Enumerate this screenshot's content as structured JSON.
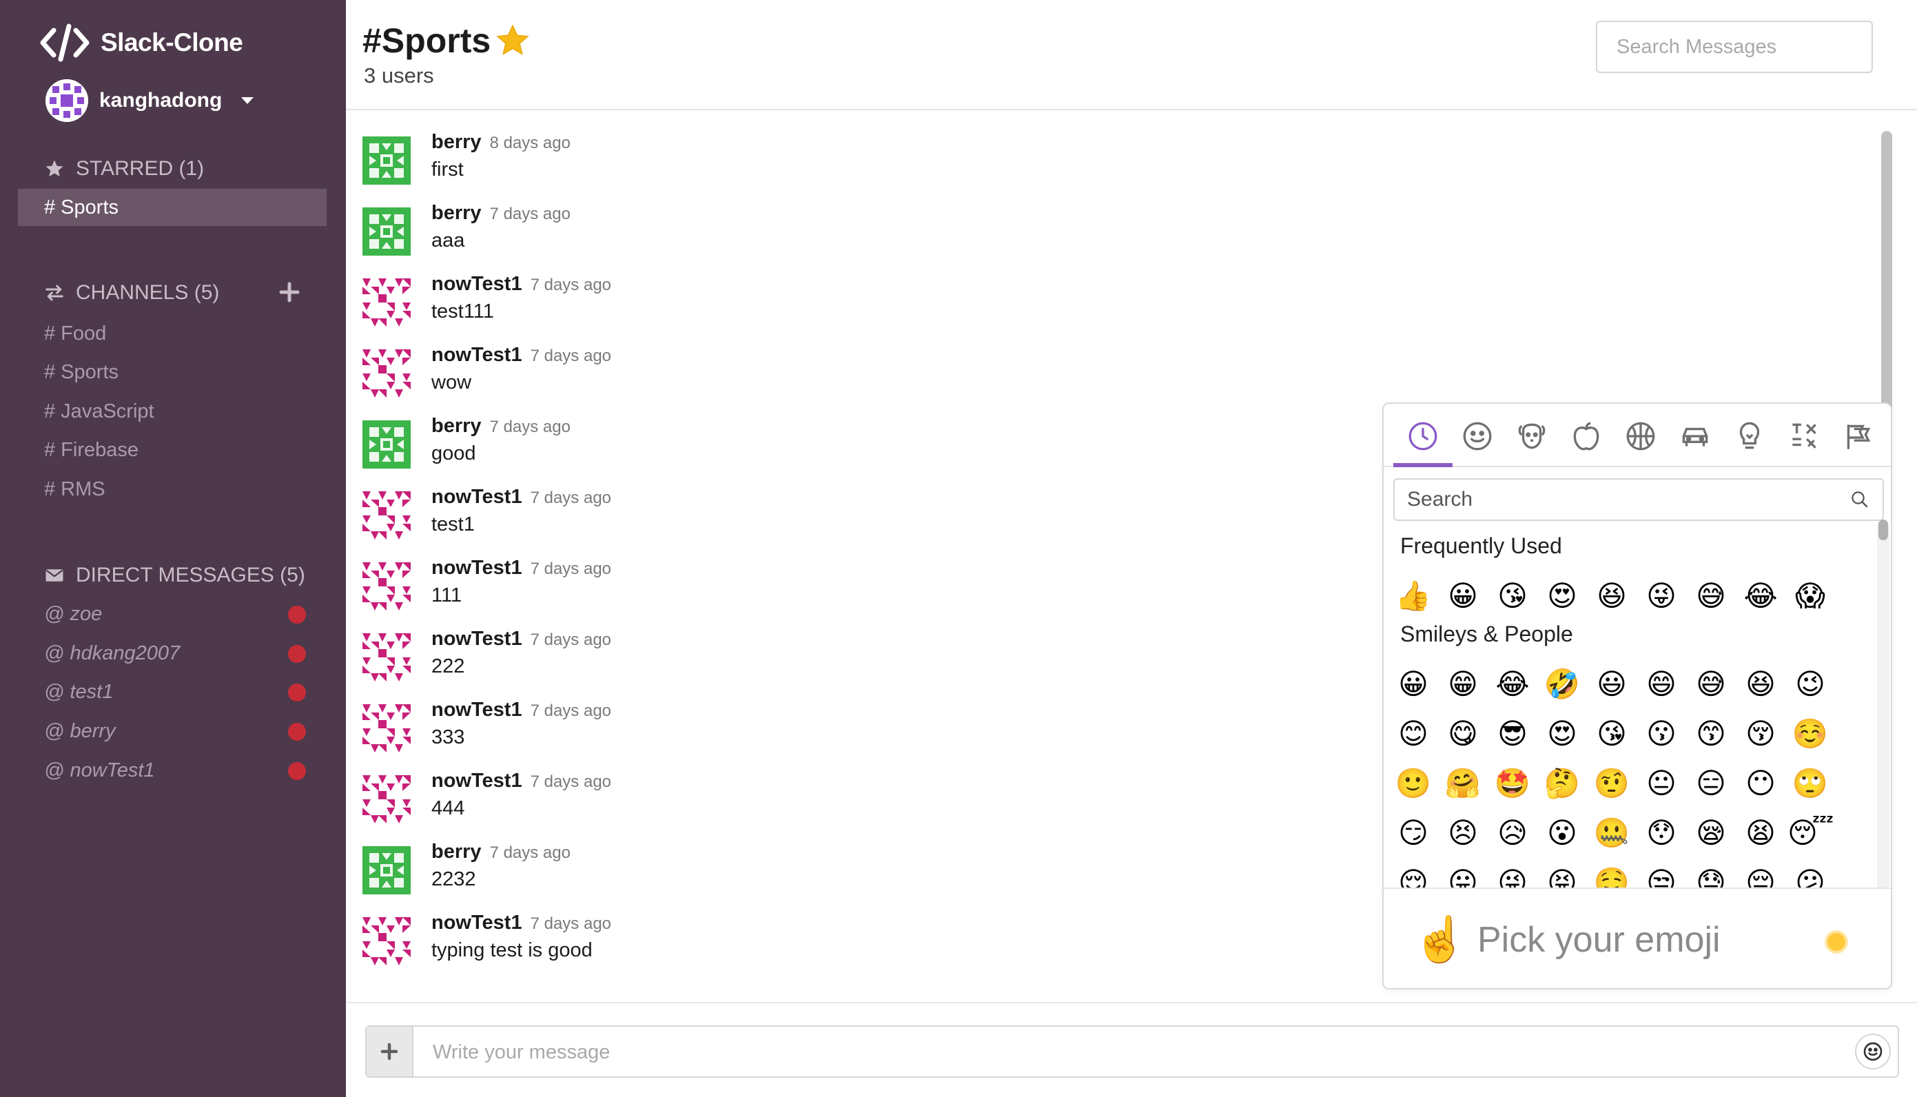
{
  "sidebar": {
    "app_name": "Slack-Clone",
    "user_name": "kanghadong",
    "starred": {
      "header": "STARRED (1)",
      "items": [
        {
          "label": "# Sports"
        }
      ]
    },
    "channels": {
      "header": "CHANNELS (5)",
      "items": [
        {
          "label": "# Food"
        },
        {
          "label": "# Sports"
        },
        {
          "label": "# JavaScript"
        },
        {
          "label": "# Firebase"
        },
        {
          "label": "# RMS"
        }
      ]
    },
    "direct_messages": {
      "header": "DIRECT MESSAGES (5)",
      "items": [
        {
          "label": "@ zoe",
          "status": "offline"
        },
        {
          "label": "@ hdkang2007",
          "status": "offline"
        },
        {
          "label": "@ test1",
          "status": "offline"
        },
        {
          "label": "@ berry",
          "status": "offline"
        },
        {
          "label": "@ nowTest1",
          "status": "offline"
        }
      ]
    }
  },
  "header": {
    "channel_title": "#Sports",
    "user_count": "3 users",
    "search_placeholder": "Search Messages"
  },
  "messages": [
    {
      "user": "berry",
      "time": "8 days ago",
      "text": "first",
      "avatar": "green"
    },
    {
      "user": "berry",
      "time": "7 days ago",
      "text": "aaa",
      "avatar": "green"
    },
    {
      "user": "nowTest1",
      "time": "7 days ago",
      "text": "test111",
      "avatar": "pink"
    },
    {
      "user": "nowTest1",
      "time": "7 days ago",
      "text": "wow",
      "avatar": "pink"
    },
    {
      "user": "berry",
      "time": "7 days ago",
      "text": "good",
      "avatar": "green"
    },
    {
      "user": "nowTest1",
      "time": "7 days ago",
      "text": "test1",
      "avatar": "pink"
    },
    {
      "user": "nowTest1",
      "time": "7 days ago",
      "text": "111",
      "avatar": "pink"
    },
    {
      "user": "nowTest1",
      "time": "7 days ago",
      "text": "222",
      "avatar": "pink"
    },
    {
      "user": "nowTest1",
      "time": "7 days ago",
      "text": "333",
      "avatar": "pink"
    },
    {
      "user": "nowTest1",
      "time": "7 days ago",
      "text": "444",
      "avatar": "pink"
    },
    {
      "user": "berry",
      "time": "7 days ago",
      "text": "2232",
      "avatar": "green"
    },
    {
      "user": "nowTest1",
      "time": "7 days ago",
      "text": "typing test is good",
      "avatar": "pink"
    }
  ],
  "emoji_picker": {
    "categories": [
      {
        "name": "recent-icon",
        "active": true
      },
      {
        "name": "smiley-icon"
      },
      {
        "name": "animal-icon"
      },
      {
        "name": "food-icon"
      },
      {
        "name": "activity-icon"
      },
      {
        "name": "travel-icon"
      },
      {
        "name": "objects-icon"
      },
      {
        "name": "symbols-icon"
      },
      {
        "name": "flags-icon"
      }
    ],
    "search_placeholder": "Search",
    "sections": [
      {
        "title": "Frequently Used",
        "rows": [
          [
            "👍",
            "😀",
            "😘",
            "😍",
            "😆",
            "😜",
            "😅",
            "😂",
            "😱"
          ]
        ]
      },
      {
        "title": "Smileys & People",
        "rows": [
          [
            "😀",
            "😁",
            "😂",
            "🤣",
            "😃",
            "😄",
            "😅",
            "😆",
            "😉"
          ],
          [
            "😊",
            "😋",
            "😎",
            "😍",
            "😘",
            "😗",
            "😙",
            "😚",
            "☺️"
          ],
          [
            "🙂",
            "🤗",
            "🤩",
            "🤔",
            "🤨",
            "😐",
            "😑",
            "😶",
            "🙄"
          ],
          [
            "😏",
            "😣",
            "😥",
            "😮",
            "🤐",
            "😯",
            "😪",
            "😫",
            "😴"
          ],
          [
            "😌",
            "😛",
            "😜",
            "😝",
            "🤤",
            "😒",
            "😓",
            "😔",
            "😕"
          ]
        ]
      }
    ],
    "preview_emoji": "☝️",
    "preview_text": "Pick your emoji"
  },
  "composer": {
    "placeholder": "Write your message"
  },
  "colors": {
    "sidebar_bg": "#4d394b",
    "accent": "#8a5bc7",
    "status_dot": "#c72c36",
    "avatar_green": "#3cb54a",
    "avatar_pink": "#c81f78"
  }
}
